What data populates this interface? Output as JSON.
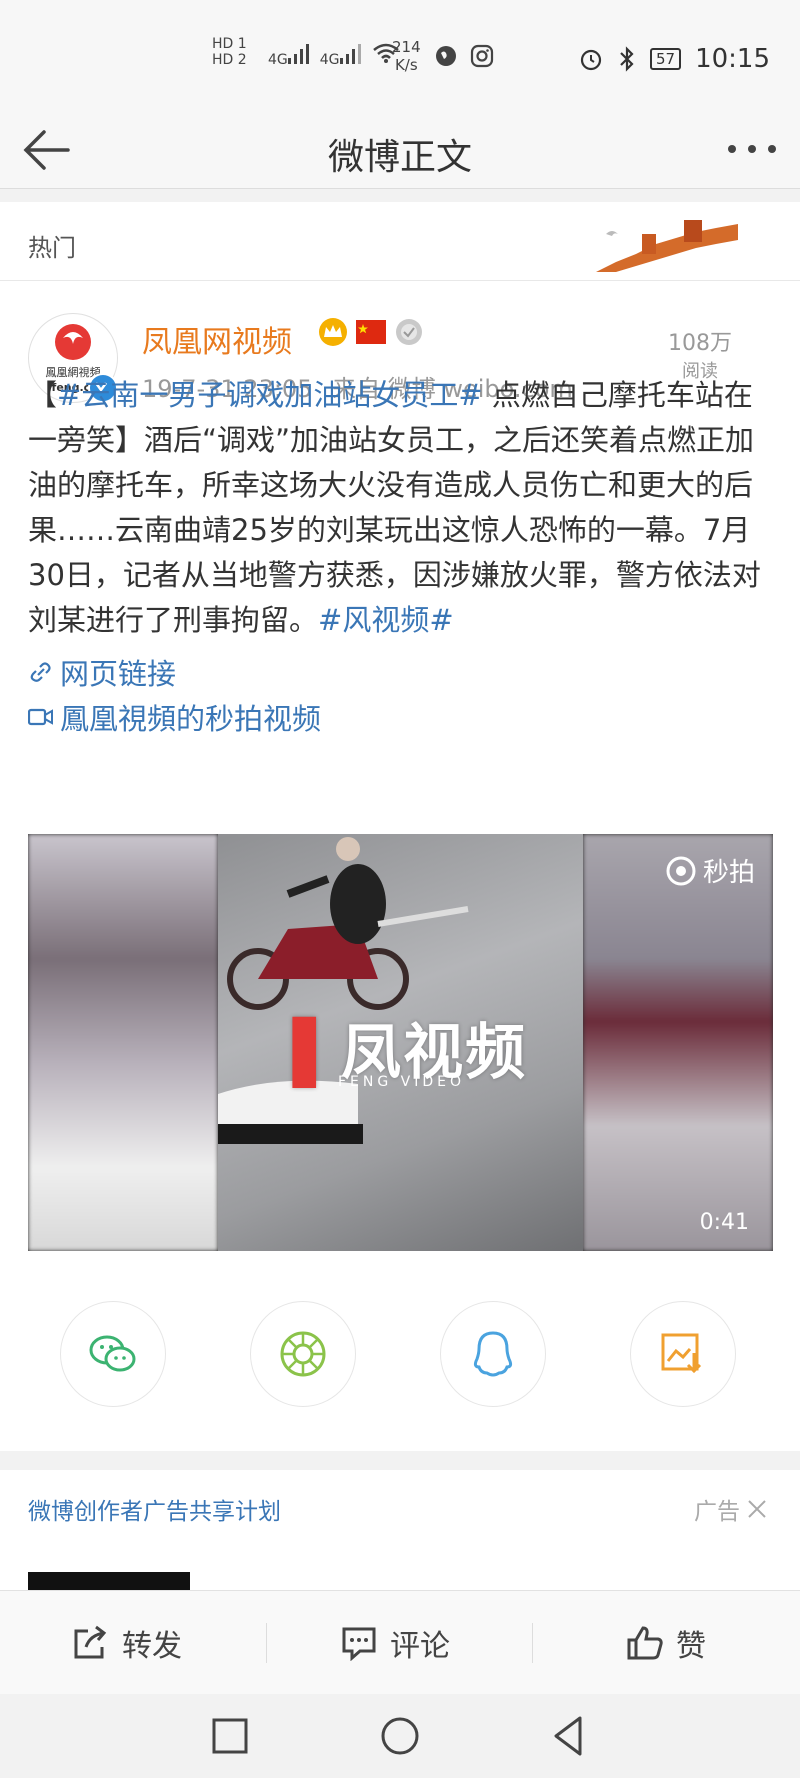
{
  "status_bar": {
    "hd1": "HD 1",
    "hd2": "HD 2",
    "sig1": "4G",
    "sig2": "4G",
    "speed_value": "214",
    "speed_unit": "K/s",
    "battery": "57",
    "time": "10:15"
  },
  "titlebar": {
    "title": "微博正文"
  },
  "hot_label": "热门",
  "post": {
    "author": "凤凰网视频",
    "avatar_text": "鳳凰網視頻",
    "avatar_domain": "ifeng.c",
    "time": "19-7-31 23:05",
    "source": "来自 微博 weibo.com",
    "reads_count": "108万",
    "reads_label": "阅读",
    "text_open": "【",
    "tag1": "#云南一男子调戏加油站女员工#",
    "text_main": " 点燃自己摩托车站在一旁笑】酒后“调戏”加油站女员工，之后还笑着点燃正加油的摩托车，所幸这场大火没有造成人员伤亡和更大的后果……云南曲靖25岁的刘某玩出这惊人恐怖的一幕。7月30日，记者从当地警方获悉，因涉嫌放火罪，警方依法对刘某进行了刑事拘留。",
    "tag2": "#风视频#",
    "link1": "网页链接",
    "link2": "鳳凰視頻的秒拍视频"
  },
  "video": {
    "watermark": "凤视频",
    "watermark_sub": "FENG VIDEO",
    "miaopai": "秒拍",
    "duration": "0:41"
  },
  "share": [
    "wechat-icon",
    "moments-icon",
    "qq-icon",
    "save-image-icon"
  ],
  "ad": {
    "title": "微博创作者广告共享计划",
    "label": "广告"
  },
  "actions": {
    "repost": "转发",
    "comment": "评论",
    "like": "赞"
  },
  "colors": {
    "link": "#3a76b6",
    "author": "#e87a1e",
    "wechat": "#3cb371",
    "moments": "#8bc34a",
    "qq": "#4aa3df",
    "save": "#f0a030"
  }
}
